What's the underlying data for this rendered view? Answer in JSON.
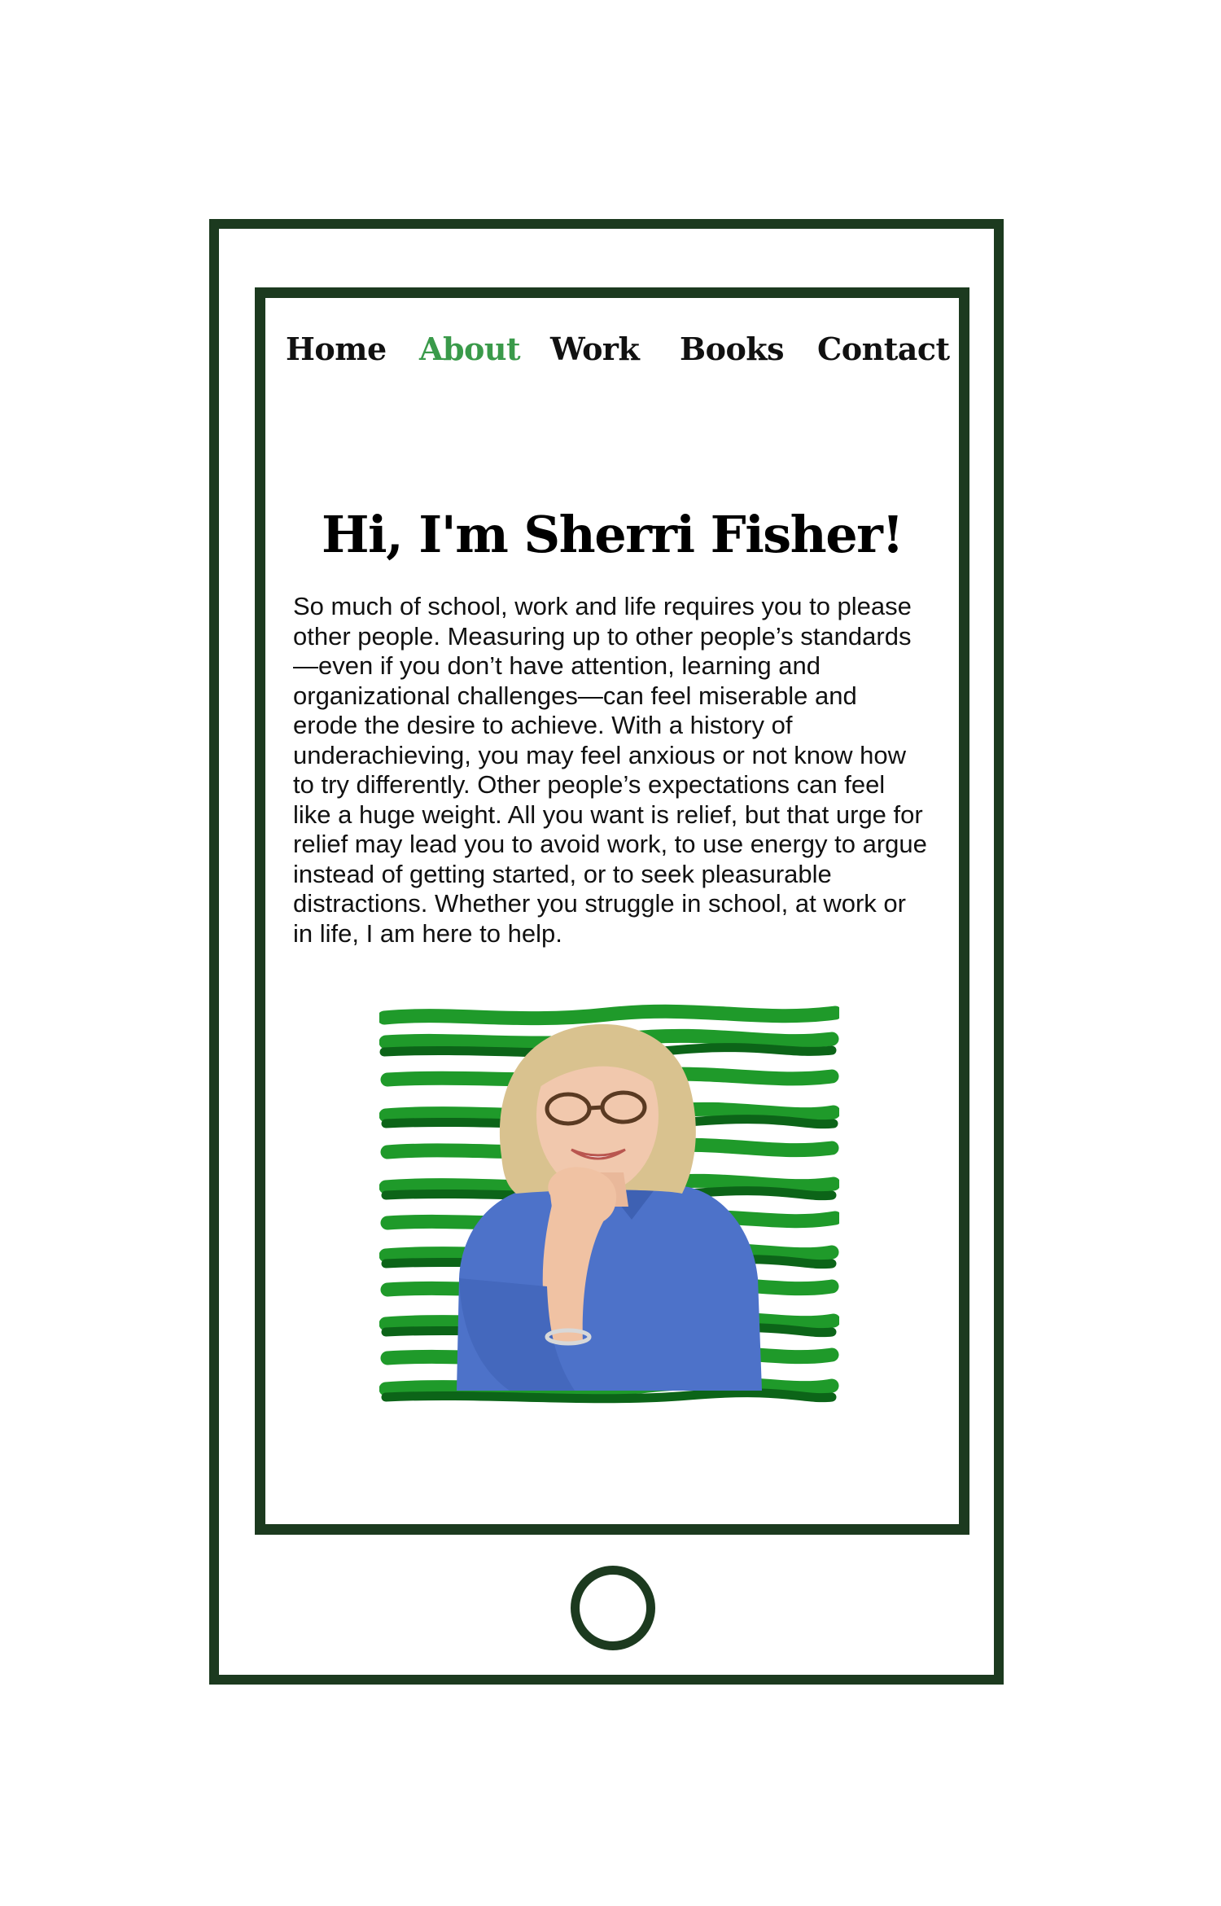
{
  "nav": {
    "items": [
      {
        "label": "Home",
        "active": false
      },
      {
        "label": "About",
        "active": true
      },
      {
        "label": "Work",
        "active": false
      },
      {
        "label": "Books",
        "active": false
      },
      {
        "label": "Contact",
        "active": false
      }
    ]
  },
  "hero": {
    "title": "Hi, I'm Sherri Fisher!",
    "intro": "So much of school, work and life requires you to please other people. Measuring up to other people’s standards—even if you don’t have attention, learning and organizational challenges—can feel miserable and erode the desire to achieve. With a history of underachieving, you may feel anxious or not know how to try differently. Other people’s expectations can feel like a huge weight. All you want is relief, but that urge for relief may lead you to avoid work, to use energy to argue instead of getting started, or to seek pleasurable distractions. Whether you struggle in school, at work or in life, I am here to help."
  },
  "colors": {
    "frame": "#1c3a1f",
    "nav_active": "#3a9a4a",
    "stripe_light": "#1f9a2a",
    "stripe_dark": "#0c6418",
    "shirt": "#4d72c9",
    "hair": "#d9c28f"
  },
  "icons": {
    "home_button": "circle-home-button-icon"
  }
}
